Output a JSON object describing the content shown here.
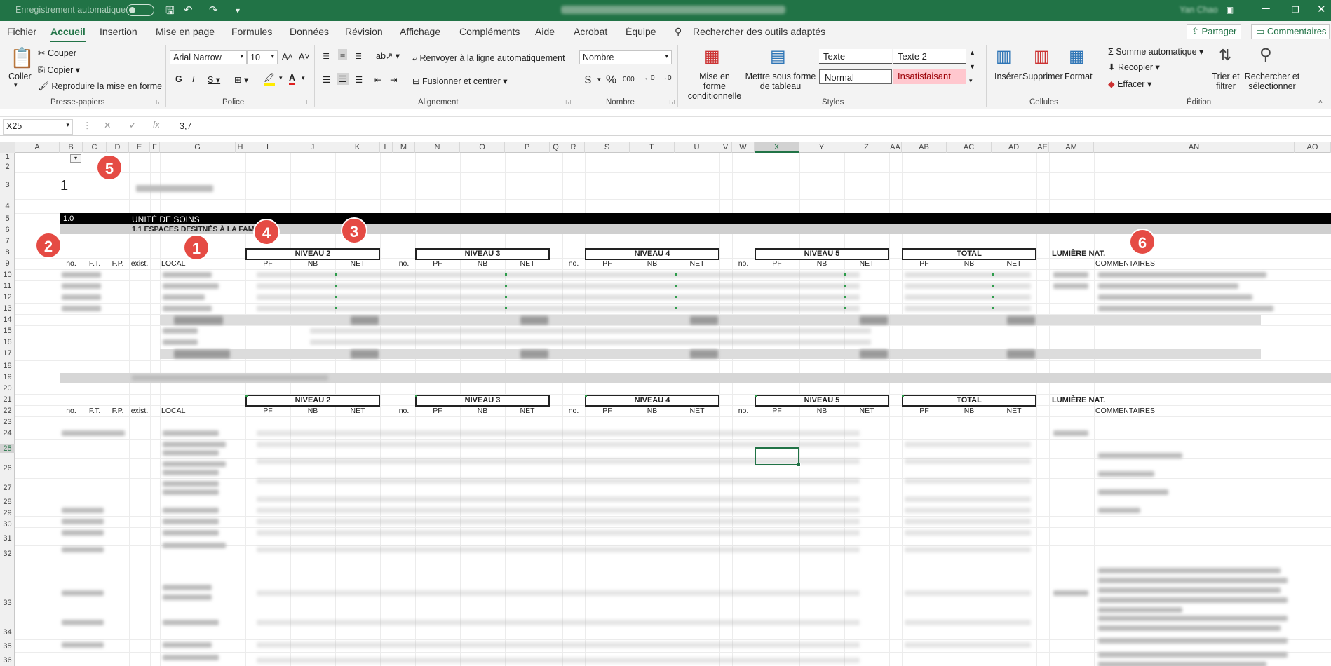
{
  "titlebar": {
    "autosave_label": "Enregistrement automatique",
    "user": "Yan Chao"
  },
  "tabs": [
    "Fichier",
    "Accueil",
    "Insertion",
    "Mise en page",
    "Formules",
    "Données",
    "Révision",
    "Affichage",
    "Compléments",
    "Aide",
    "Acrobat",
    "Équipe"
  ],
  "search_tools": "Rechercher des outils adaptés",
  "share_label": "Partager",
  "comments_label": "Commentaires",
  "ribbon": {
    "clipboard": {
      "paste": "Coller",
      "cut": "Couper",
      "copy": "Copier",
      "format_painter": "Reproduire la mise en forme",
      "label": "Presse-papiers"
    },
    "font": {
      "name": "Arial Narrow",
      "size": "10",
      "label": "Police"
    },
    "alignment": {
      "wrap": "Renvoyer à la ligne automatiquement",
      "merge": "Fusionner et centrer",
      "label": "Alignement"
    },
    "number": {
      "format": "Nombre",
      "label": "Nombre"
    },
    "styles": {
      "cond_format": "Mise en forme conditionnelle",
      "as_table": "Mettre sous forme de tableau",
      "texte": "Texte",
      "texte2": "Texte 2",
      "normal": "Normal",
      "insatisfaisant": "Insatisfaisant",
      "label": "Styles"
    },
    "cells": {
      "insert": "Insérer",
      "delete": "Supprimer",
      "format": "Format",
      "label": "Cellules"
    },
    "editing": {
      "autosum": "Somme automatique",
      "fill": "Recopier",
      "clear": "Effacer",
      "sort": "Trier et filtrer",
      "find": "Rechercher et sélectionner",
      "label": "Édition"
    }
  },
  "formula_bar": {
    "name_box": "X25",
    "value": "3,7"
  },
  "columns": [
    "A",
    "B",
    "C",
    "D",
    "E",
    "F",
    "G",
    "H",
    "I",
    "J",
    "K",
    "L",
    "M",
    "N",
    "O",
    "P",
    "Q",
    "R",
    "S",
    "T",
    "U",
    "V",
    "W",
    "X",
    "Y",
    "Z",
    "AA",
    "AB",
    "AC",
    "AD",
    "AE",
    "AM",
    "AN",
    "AO"
  ],
  "rows": [
    "1",
    "2",
    "3",
    "4",
    "5",
    "6",
    "7",
    "8",
    "9",
    "10",
    "11",
    "12",
    "13",
    "14",
    "15",
    "16",
    "17",
    "18",
    "19",
    "20",
    "21",
    "22",
    "23",
    "24",
    "25",
    "26",
    "27",
    "28",
    "29",
    "30",
    "31",
    "32",
    "33",
    "34",
    "35",
    "36"
  ],
  "sheet": {
    "big_one": "1",
    "section_code": "1.0",
    "section_title": "UNITÉ DE SOINS",
    "subsection": "1.1 ESPACES DESITNÉS À LA FAMIL",
    "levels": [
      "NIVEAU 2",
      "NIVEAU 3",
      "NIVEAU 4",
      "NIVEAU 5",
      "TOTAL"
    ],
    "lumiere": "LUMIÈRE NAT.",
    "left_headers": [
      "no.",
      "F.T.",
      "F.P.",
      "exist."
    ],
    "local": "LOCAL",
    "pf": "PF",
    "nb": "NB",
    "net": "NET",
    "no": "no.",
    "commentaires": "COMMENTAIRES"
  },
  "badges": [
    "1",
    "2",
    "3",
    "4",
    "5",
    "6"
  ]
}
